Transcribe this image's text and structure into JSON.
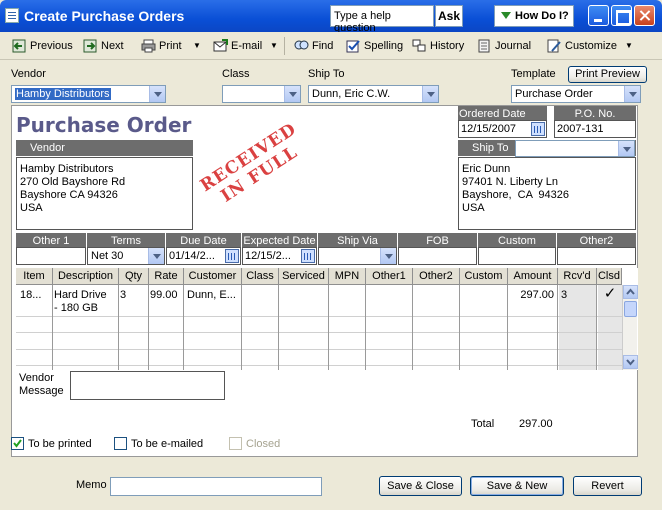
{
  "window": {
    "title": "Create Purchase Orders",
    "help_placeholder": "Type a help question",
    "ask_label": "Ask",
    "howdo_label": "How Do I?"
  },
  "toolbar": {
    "previous": "Previous",
    "next": "Next",
    "print": "Print",
    "email": "E-mail",
    "find": "Find",
    "spelling": "Spelling",
    "history": "History",
    "journal": "Journal",
    "customize": "Customize"
  },
  "header": {
    "vendor_label": "Vendor",
    "vendor_value": "Hamby Distributors",
    "class_label": "Class",
    "class_value": "",
    "shipto_label": "Ship To",
    "shipto_value": "Dunn, Eric C.W.",
    "template_label": "Template",
    "template_value": "Purchase Order",
    "print_preview": "Print Preview"
  },
  "form": {
    "title": "Purchase Order",
    "ordered_date_label": "Ordered Date",
    "ordered_date": "12/15/2007",
    "po_no_label": "P.O. No.",
    "po_no": "2007-131",
    "vendor_box_label": "Vendor",
    "vendor_address": [
      "Hamby Distributors",
      "270 Old Bayshore Rd",
      "Bayshore CA 94326",
      "USA"
    ],
    "shipto_box_label": "Ship To",
    "shipto_address": [
      "Eric Dunn",
      "97401 N. Liberty Ln",
      "Bayshore,  CA  94326",
      "USA"
    ],
    "stamp_line1": "RECEIVED",
    "stamp_line2": "IN FULL"
  },
  "info_row": {
    "headers": [
      "Other 1",
      "Terms",
      "Due Date",
      "Expected Date",
      "Ship Via",
      "FOB",
      "Custom",
      "Other2"
    ],
    "terms": "Net 30",
    "due_date": "01/14/2...",
    "expected_date": "12/15/2..."
  },
  "grid": {
    "columns": [
      "Item",
      "Description",
      "Qty",
      "Rate",
      "Customer",
      "Class",
      "Serviced",
      "MPN",
      "Other1",
      "Other2",
      "Custom",
      "Amount",
      "Rcv'd",
      "Clsd"
    ],
    "row": {
      "item": "18...",
      "description": "Hard Drive\n- 180 GB",
      "qty": "3",
      "rate": "99.00",
      "customer": "Dunn, E...",
      "amount": "297.00",
      "rcvd": "3",
      "clsd": "✓"
    }
  },
  "footer": {
    "vendor_message_label": "Vendor\nMessage",
    "total_label": "Total",
    "total_value": "297.00",
    "to_be_printed": "To be printed",
    "to_be_emailed": "To be e-mailed",
    "closed": "Closed",
    "memo_label": "Memo",
    "save_close": "Save & Close",
    "save_new": "Save & New",
    "revert": "Revert"
  }
}
